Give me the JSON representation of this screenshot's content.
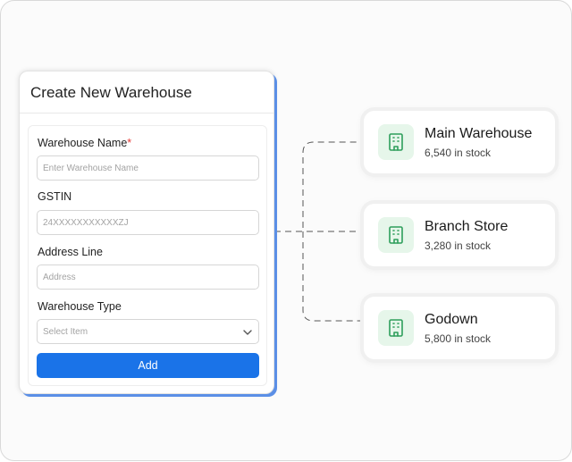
{
  "form": {
    "title": "Create New Warehouse",
    "fields": [
      {
        "label": "Warehouse Name",
        "required": true,
        "placeholder": "Enter Warehouse Name"
      },
      {
        "label": "GSTIN",
        "required": false,
        "placeholder": "24XXXXXXXXXXXZJ"
      },
      {
        "label": "Address Line",
        "required": false,
        "placeholder": "Address"
      }
    ],
    "warehouse_type": {
      "label": "Warehouse Type",
      "placeholder": "Select Item",
      "icon": "chevron-down-icon"
    },
    "required_marker": "*",
    "add_label": "Add",
    "accent_color": "#1a73e8"
  },
  "warehouses": [
    {
      "name": "Main Warehouse",
      "stock": "6,540 in stock",
      "icon": "building-icon"
    },
    {
      "name": "Branch Store",
      "stock": "3,280 in stock",
      "icon": "building-icon"
    },
    {
      "name": "Godown",
      "stock": "5,800 in stock",
      "icon": "building-icon"
    }
  ],
  "colors": {
    "icon_green": "#2e9e5b",
    "icon_bg": "#e6f6ea",
    "connector": "#555555"
  }
}
